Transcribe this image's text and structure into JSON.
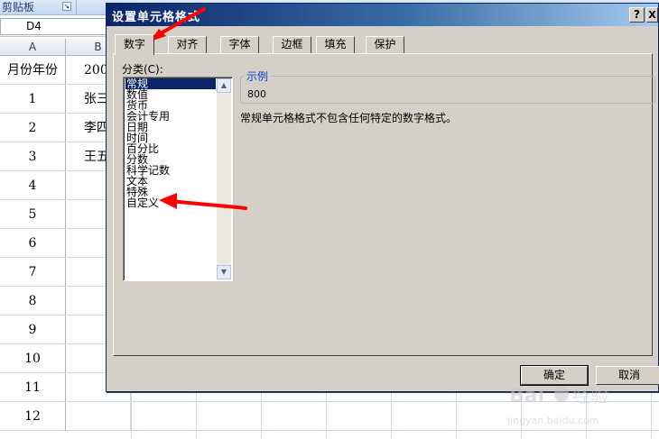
{
  "excel": {
    "ribbon": {
      "clipboard_label": "剪贴板"
    },
    "name_box": {
      "value": "D4"
    },
    "column_headers": [
      "A",
      "B"
    ],
    "rows": [
      {
        "row_number": "",
        "a": "月份年份",
        "b": "200"
      },
      {
        "row_number": "",
        "a": "1",
        "b": "张三"
      },
      {
        "row_number": "",
        "a": "2",
        "b": "李四"
      },
      {
        "row_number": "",
        "a": "3",
        "b": "王五"
      },
      {
        "row_number": "",
        "a": "4",
        "b": ""
      },
      {
        "row_number": "",
        "a": "5",
        "b": ""
      },
      {
        "row_number": "",
        "a": "6",
        "b": ""
      },
      {
        "row_number": "",
        "a": "7",
        "b": ""
      },
      {
        "row_number": "",
        "a": "8",
        "b": ""
      },
      {
        "row_number": "",
        "a": "9",
        "b": ""
      },
      {
        "row_number": "",
        "a": "10",
        "b": ""
      },
      {
        "row_number": "",
        "a": "11",
        "b": ""
      },
      {
        "row_number": "",
        "a": "12",
        "b": ""
      }
    ]
  },
  "dialog": {
    "title": "设置单元格格式",
    "help_label": "?",
    "close_label": "X",
    "tabs": [
      "数字",
      "对齐",
      "字体",
      "边框",
      "填充",
      "保护"
    ],
    "active_tab": "数字",
    "category_label": "分类(C):",
    "categories": [
      "常规",
      "数值",
      "货币",
      "会计专用",
      "日期",
      "时间",
      "百分比",
      "分数",
      "科学记数",
      "文本",
      "特殊",
      "自定义"
    ],
    "selected_category": "常规",
    "sample_legend": "示例",
    "sample_value": "800",
    "description": "常规单元格格式不包含任何特定的数字格式。",
    "ok_label": "确定",
    "cancel_label": "取消"
  },
  "annotation_color": "#ff0000",
  "watermark": {
    "brand": "Bai",
    "brand2": "经验",
    "url": "jingyan.baidu.com"
  }
}
